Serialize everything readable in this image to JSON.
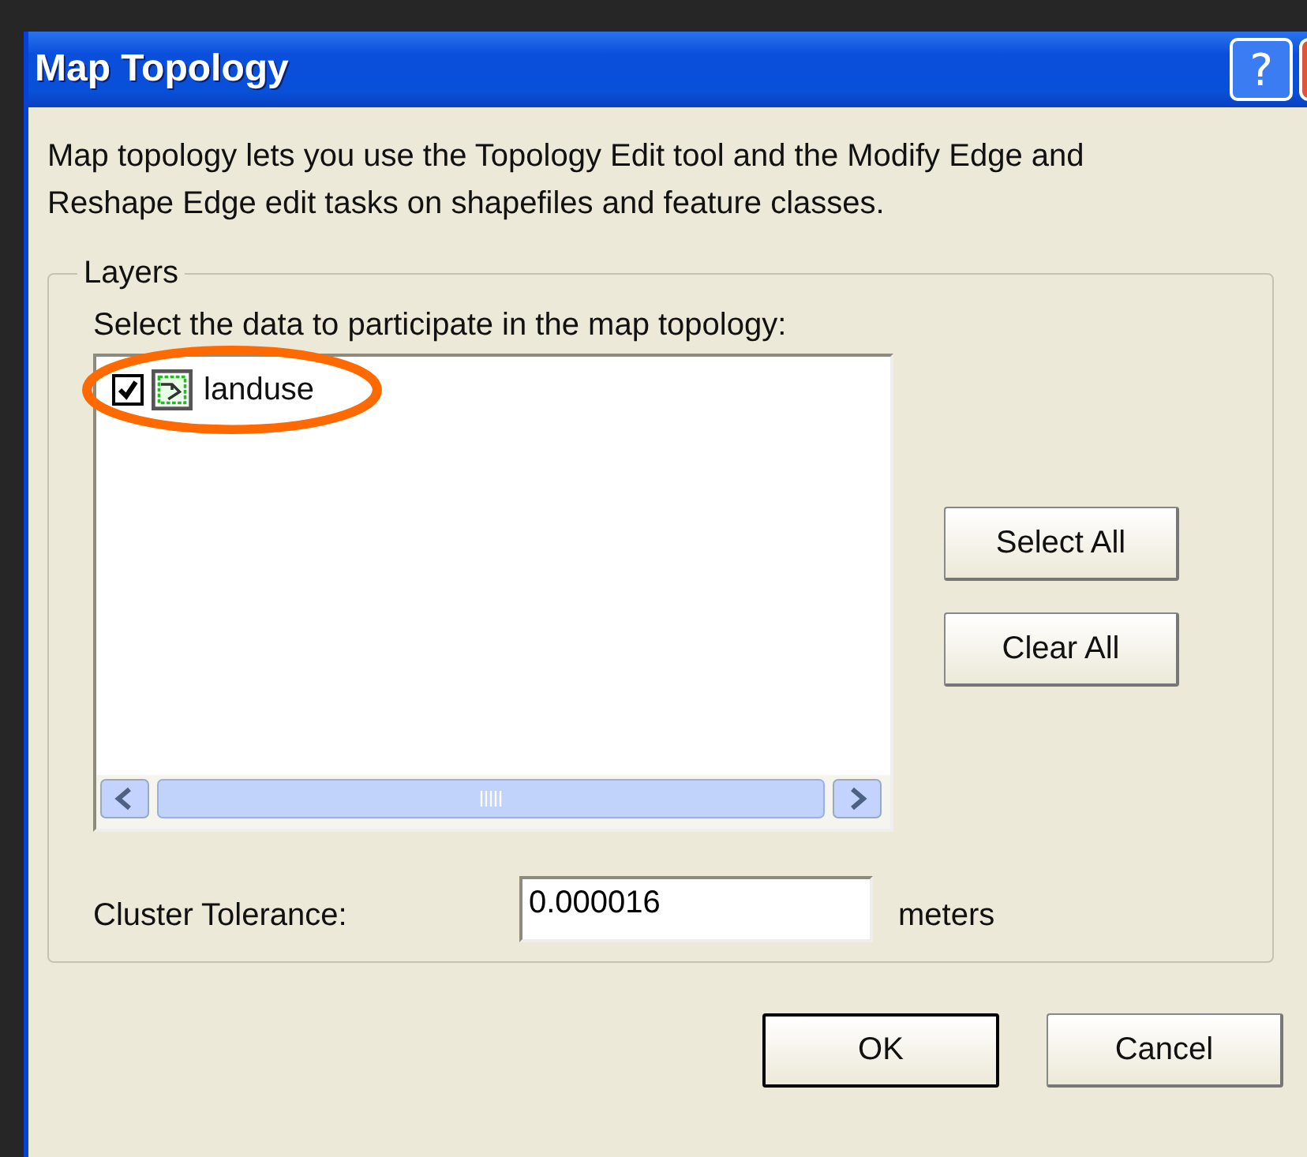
{
  "window": {
    "title": "Map Topology",
    "help_button": "?"
  },
  "description": "Map topology lets you use the Topology Edit tool and the Modify Edge and Reshape Edge edit tasks on shapefiles and feature classes.",
  "layers": {
    "legend": "Layers",
    "prompt": "Select the data to participate in the map topology:",
    "items": [
      {
        "label": "landuse",
        "checked": true,
        "highlighted": true
      }
    ],
    "buttons": [
      "Select All",
      "Clear All"
    ]
  },
  "cluster_tolerance": {
    "label": "Cluster Tolerance:",
    "value": "0.000016",
    "unit": "meters"
  },
  "buttons": [
    {
      "label": "OK",
      "default": true
    },
    {
      "label": "Cancel",
      "default": false
    }
  ]
}
